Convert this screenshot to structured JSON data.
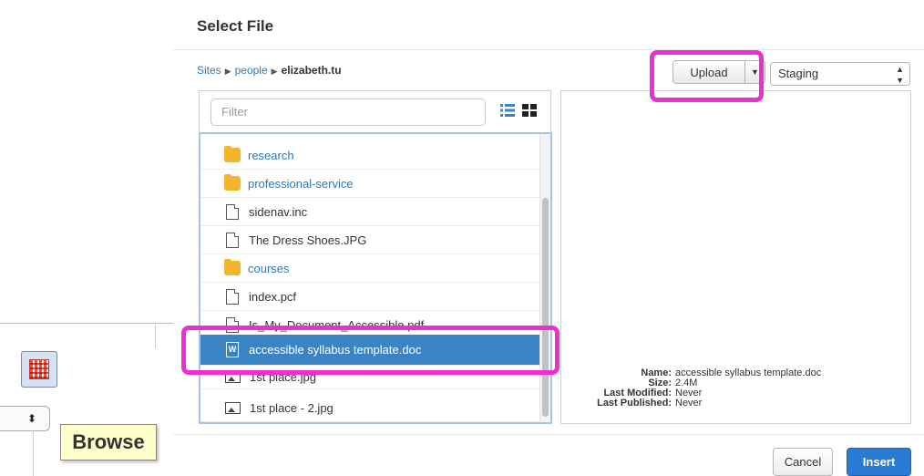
{
  "dialog": {
    "title": "Select File",
    "breadcrumb": {
      "root": "Sites",
      "middle": "people",
      "current": "elizabeth.tu"
    },
    "upload_label": "Upload",
    "environment": "Staging",
    "filter_placeholder": "Filter",
    "files": [
      {
        "name": "research",
        "type": "folder"
      },
      {
        "name": "professional-service",
        "type": "folder"
      },
      {
        "name": "sidenav.inc",
        "type": "file"
      },
      {
        "name": "The Dress Shoes.JPG",
        "type": "file"
      },
      {
        "name": "courses",
        "type": "folder"
      },
      {
        "name": "index.pcf",
        "type": "file"
      },
      {
        "name": "Is_My_Document_Accessible.pdf",
        "type": "pdf"
      },
      {
        "name": "accessible syllabus template.doc",
        "type": "doc",
        "selected": true
      },
      {
        "name": "1st place.jpg",
        "type": "image"
      },
      {
        "name": "1st place - 2.jpg",
        "type": "image"
      }
    ],
    "details": {
      "name_label": "Name:",
      "name": "accessible syllabus template.doc",
      "size_label": "Size:",
      "size": "2.4M",
      "modified_label": "Last Modified:",
      "modified": "Never",
      "published_label": "Last Published:",
      "published": "Never"
    },
    "cancel_label": "Cancel",
    "insert_label": "Insert"
  },
  "background": {
    "browse_tooltip": "Browse",
    "select_arrows": "⬍"
  },
  "colors": {
    "highlight": "#ee2fd0",
    "accent": "#2a7bd4",
    "selected_row": "#3b84c4",
    "folder": "#f3b52c"
  }
}
